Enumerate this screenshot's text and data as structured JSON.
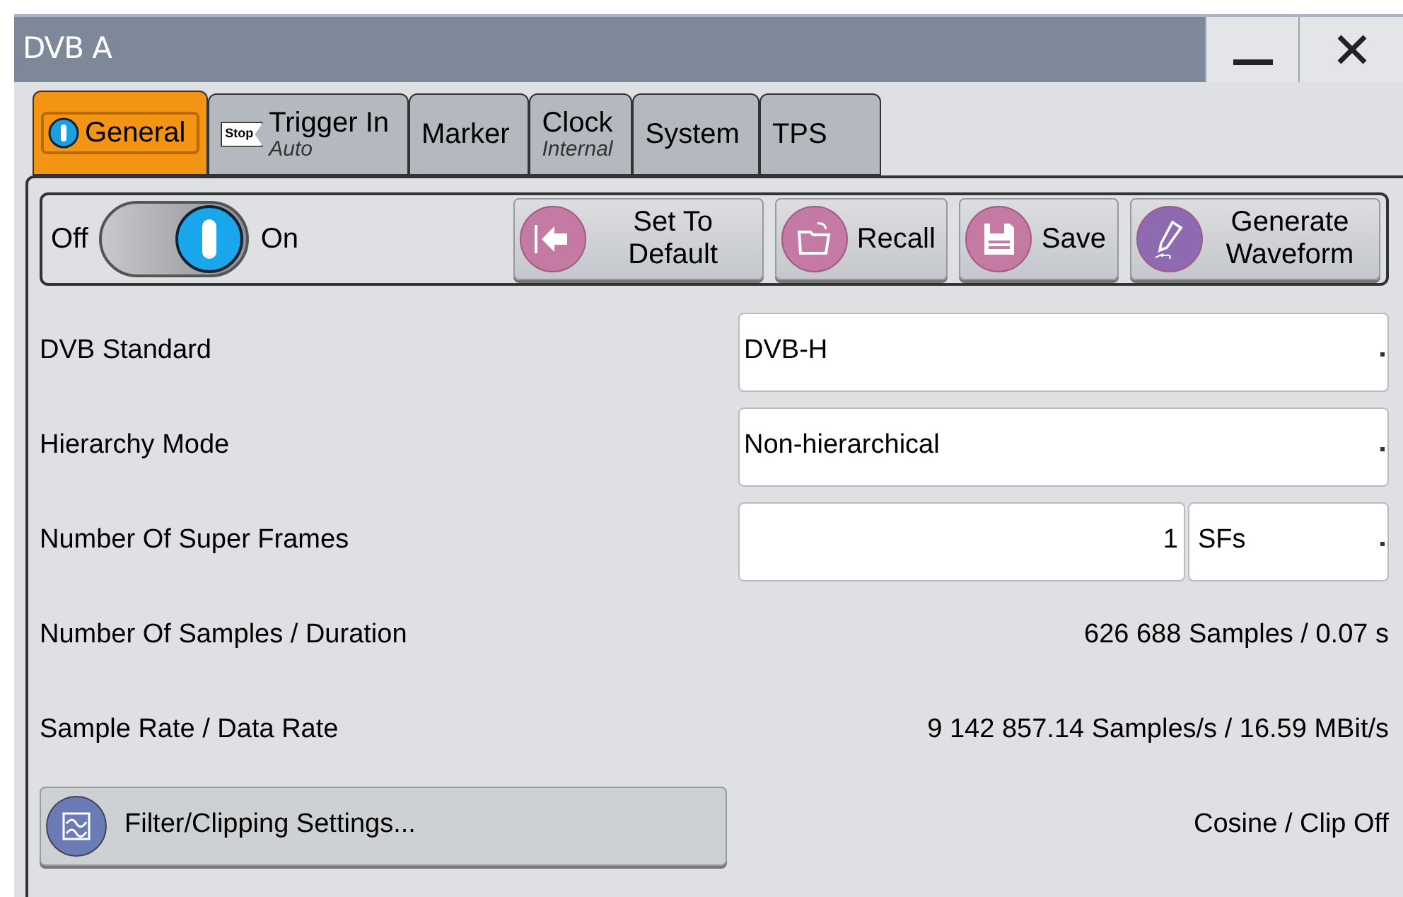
{
  "window": {
    "title": "DVB A"
  },
  "tabs": [
    {
      "label": "General",
      "selected": true
    },
    {
      "label": "Trigger In",
      "sublabel": "Auto",
      "badge": "Stop",
      "selected": false
    },
    {
      "label": "Marker",
      "selected": false
    },
    {
      "label": "Clock",
      "sublabel": "Internal",
      "selected": false
    },
    {
      "label": "System",
      "selected": false
    },
    {
      "label": "TPS",
      "selected": false
    }
  ],
  "toolbar": {
    "toggle": {
      "off_label": "Off",
      "on_label": "On",
      "on": true
    },
    "buttons": [
      {
        "label": "Set To Default"
      },
      {
        "label": "Recall"
      },
      {
        "label": "Save"
      },
      {
        "label": "Generate Waveform"
      }
    ]
  },
  "rows": [
    {
      "kind": "dropdown",
      "label": "DVB Standard",
      "value": "DVB-H"
    },
    {
      "kind": "dropdown",
      "label": "Hierarchy Mode",
      "value": "Non-hierarchical"
    },
    {
      "kind": "number_unit",
      "label": "Number Of Super Frames",
      "value": "1",
      "unit": "SFs"
    },
    {
      "kind": "readout",
      "label": "Number Of Samples / Duration",
      "value": "626 688 Samples /  0.07 s"
    },
    {
      "kind": "readout",
      "label": "Sample Rate / Data Rate",
      "value": "9 142 857.14 Samples/s /  16.59 MBit/s"
    },
    {
      "kind": "button",
      "label": "Filter/Clipping Settings...",
      "value": "Cosine / Clip Off"
    }
  ]
}
